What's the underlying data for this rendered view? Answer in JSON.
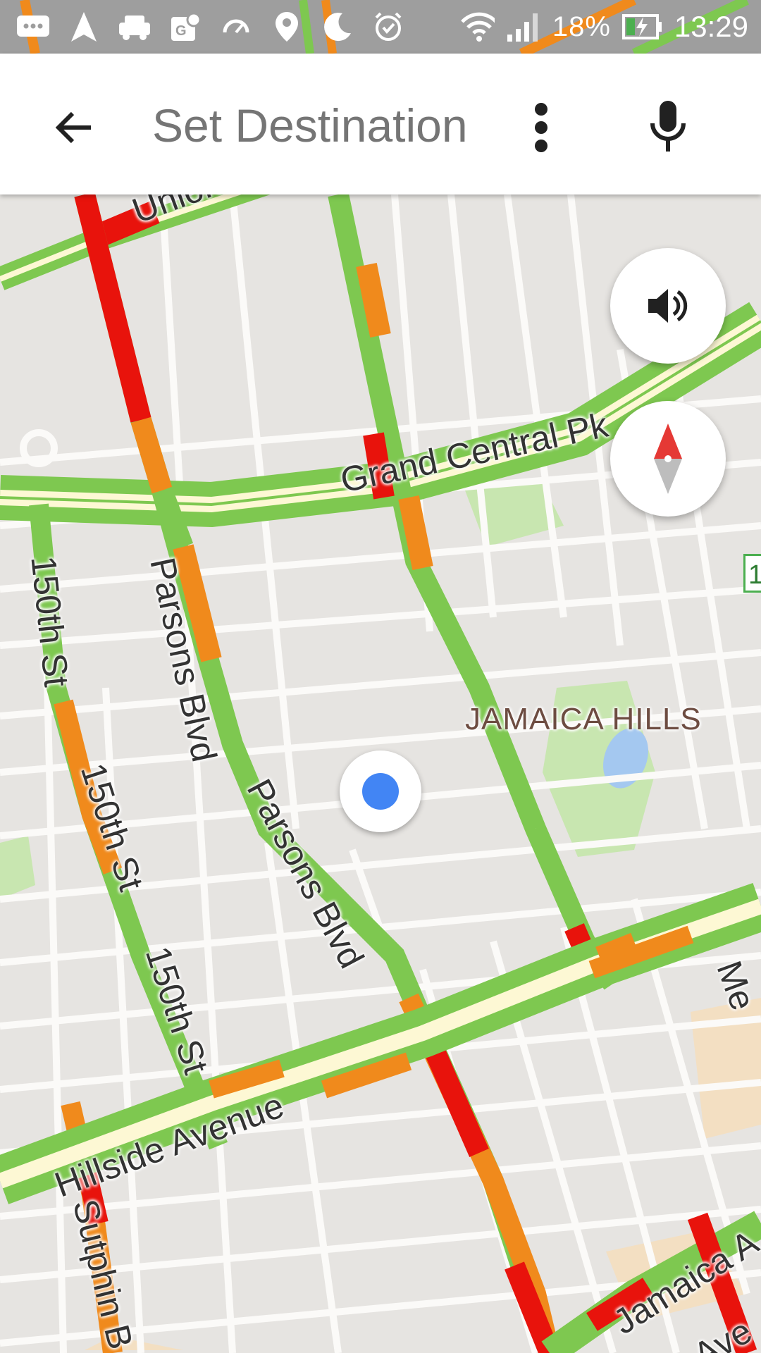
{
  "status_bar": {
    "icons": [
      "message-icon",
      "navigation-icon",
      "car-icon",
      "maps-icon",
      "speedometer-icon",
      "location-icon",
      "moon-icon",
      "alarm-icon",
      "wifi-icon",
      "signal-icon",
      "battery-charging-icon"
    ],
    "battery_percent": "18%",
    "time": "13:29"
  },
  "app_bar": {
    "back_icon": "arrow-back-icon",
    "title_placeholder": "Set Destination",
    "more_icon": "more-vert-icon",
    "mic_icon": "microphone-icon"
  },
  "map": {
    "labels": {
      "union_tpke": "Union Tp",
      "grand_central": "Grand Central Pk",
      "parsons_blvd_1": "Parsons Blvd",
      "parsons_blvd_2": "Parsons Blvd",
      "st150_1": "150th St",
      "st150_2": "150th St",
      "st150_3": "150th St",
      "jamaica_hills": "JAMAICA HILLS",
      "hillside_ave": "Hillside Avenue",
      "sutphin": "Sutphin B",
      "jamaica_ave": "Jamaica A",
      "partial_me": "Me",
      "partial_ave": "r Ave"
    },
    "edge_marker": "1",
    "traffic_colors": {
      "free": "#7ec850",
      "moderate": "#f08a1c",
      "heavy": "#e8130c"
    }
  },
  "controls": {
    "sound_icon": "volume-icon",
    "compass_icon": "compass-icon",
    "location_icon": "my-location-dot-icon"
  }
}
